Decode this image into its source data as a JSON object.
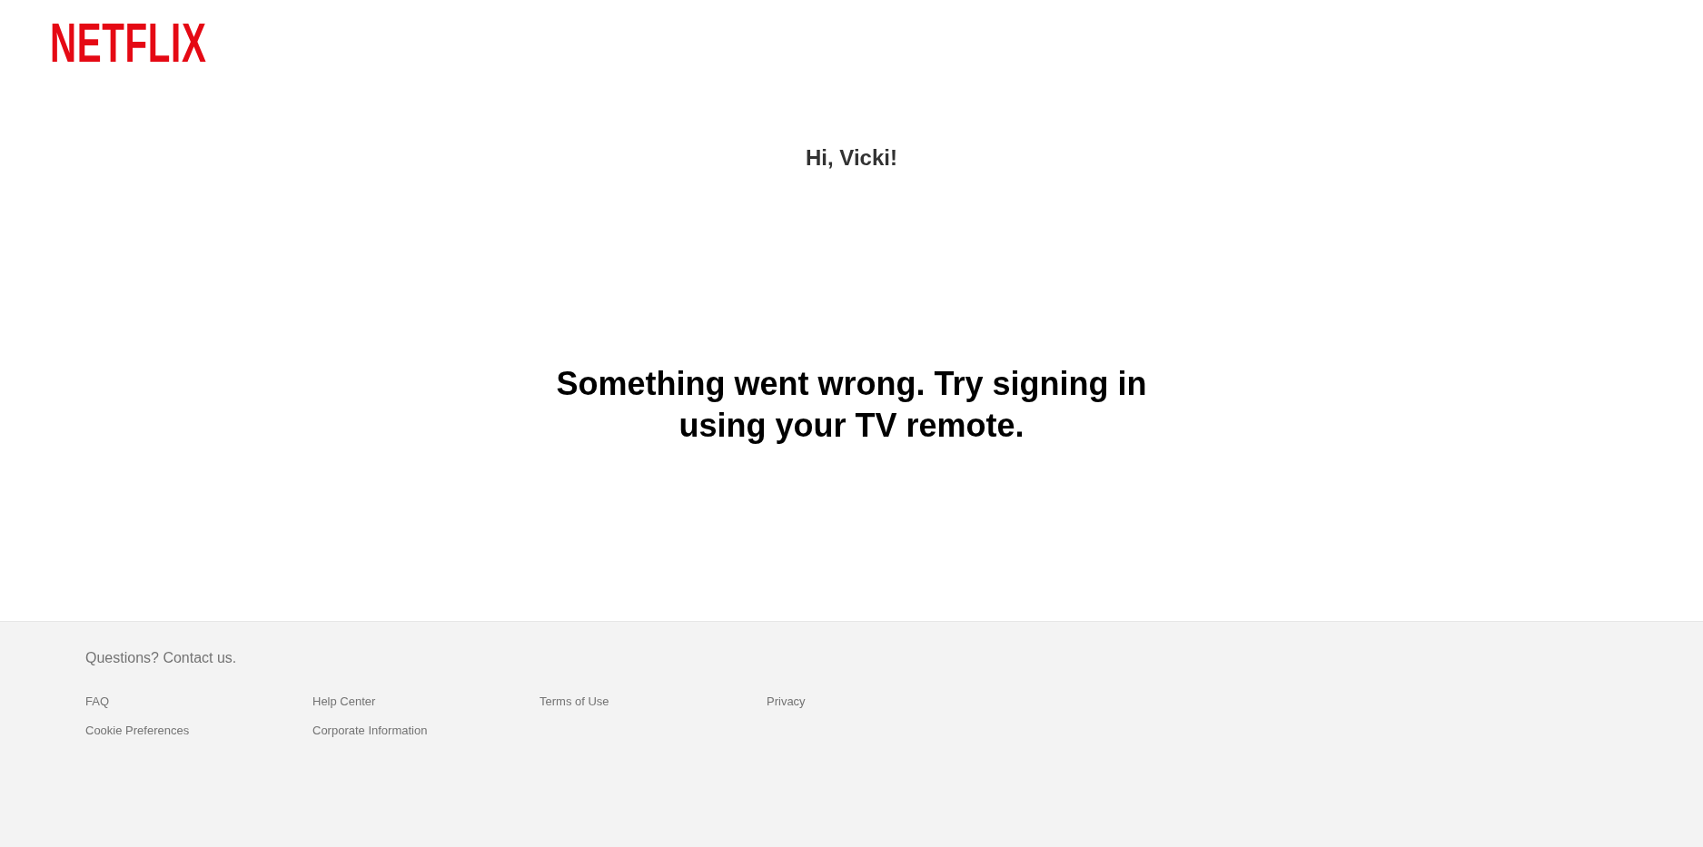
{
  "logo": {
    "text": "NETFLIX"
  },
  "greeting": "Hi, Vicki!",
  "message": "Something went wrong. Try signing in using your TV remote.",
  "footer": {
    "contact": "Questions? Contact us.",
    "links": [
      "FAQ",
      "Help Center",
      "Terms of Use",
      "Privacy",
      "Cookie Preferences",
      "Corporate Information"
    ]
  }
}
